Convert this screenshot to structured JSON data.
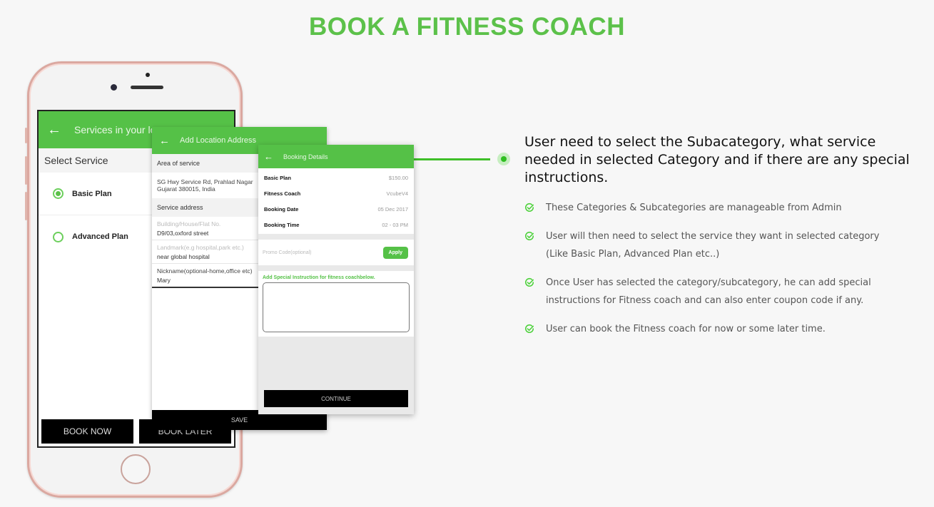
{
  "page": {
    "title": "BOOK A FITNESS COACH"
  },
  "screen1": {
    "header_title": "Services in your loc",
    "back_icon": "arrow-left-icon",
    "subheader": "Select Service",
    "plans": [
      {
        "label": "Basic Plan",
        "selected": true
      },
      {
        "label": "Advanced Plan",
        "selected": false
      }
    ],
    "book_now": "BOOK NOW",
    "book_later": "BOOK LATER"
  },
  "screen2": {
    "header_title": "Add Location Address",
    "back_icon": "arrow-left-icon",
    "area_label": "Area of service",
    "area_value_line1": "SG Hwy Service Rd, Prahlad Nagar",
    "area_value_line2": "Gujarat 380015, India",
    "service_address_label": "Service address",
    "fields": [
      {
        "placeholder": "Building/House/Flat No.",
        "value": "D9/03,oxford street"
      },
      {
        "placeholder": "Landmark(e.g hospital,park etc.)",
        "value": "near global hospital"
      },
      {
        "placeholder": "Nickname(optional-home,office etc)",
        "value": "Mary"
      }
    ],
    "save": "SAVE"
  },
  "screen3": {
    "header_title": "Booking Details",
    "back_icon": "arrow-left-icon",
    "details": [
      {
        "key": "Basic Plan",
        "value": "$150.00"
      },
      {
        "key": "Fitness Coach",
        "value": "VcubeV4"
      },
      {
        "key": "Booking Date",
        "value": "05 Dec 2017"
      },
      {
        "key": "Booking Time",
        "value": "02 - 03 PM"
      }
    ],
    "promo_placeholder": "Promo Code(optional)",
    "apply": "Apply",
    "instruction_label": "Add Special Instruction for fitness coachbelow.",
    "instruction_value": "",
    "continue": "CONTINUE"
  },
  "description": {
    "headline": "User need to select the Subacategory, what service needed in selected Category and if there are any special instructions.",
    "bullets": [
      "These Categories & Subcategories are manageable from Admin",
      "User will then need to select the service they want in selected category (Like Basic Plan, Advanced Plan etc..)",
      "Once User has selected the category/subcategory, he can add special instructions for Fitness coach and can also enter coupon code if any.",
      "User can book the Fitness coach for now or some later time."
    ],
    "bullet_icon": "check-circle-icon"
  },
  "colors": {
    "accent": "#5cc14a",
    "header_green": "#55c147",
    "connector": "#3fbf2a"
  }
}
